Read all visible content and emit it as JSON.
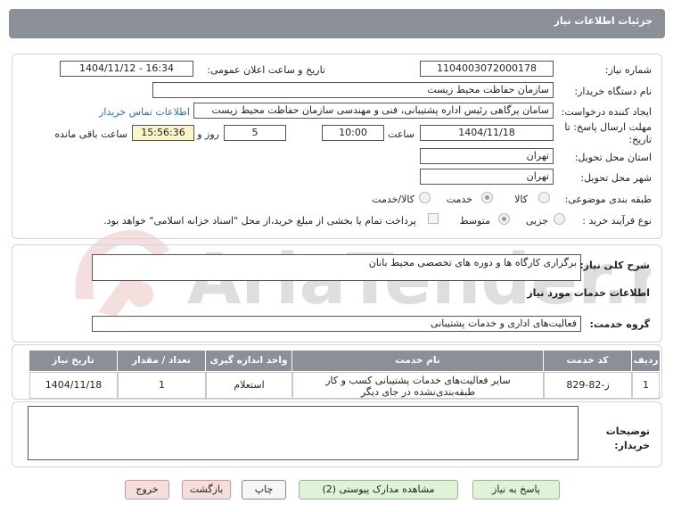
{
  "header": {
    "title": "جزئیات اطلاعات نیاز"
  },
  "watermark": {
    "text": "AriaTender.net"
  },
  "form": {
    "need_number_label": "شماره نیاز:",
    "need_number": "1104003072000178",
    "announce_label": "تاریخ و ساعت اعلان عمومی:",
    "announce_value": "1404/11/12 - 16:34",
    "buyer_org_label": "نام دستگاه خریدار:",
    "buyer_org": "سازمان حفاظت محیط زیست",
    "creator_label": "ایجاد کننده درخواست:",
    "creator": "سامان پرگاهی رئیس اداره پشتیبانی، فنی و مهندسی سازمان حفاظت محیط زیست",
    "contact_link": "اطلاعات تماس خریدار",
    "deadline_label": "مهلت ارسال پاسخ: تا تاریخ:",
    "deadline_date": "1404/11/18",
    "time_label": "ساعت",
    "deadline_time": "10:00",
    "days_value": "5",
    "days_label": "روز و",
    "remaining_time": "15:56:36",
    "remaining_label": "ساعت باقی مانده",
    "province_label": "استان محل تحویل:",
    "province": "تهران",
    "city_label": "شهر محل تحویل:",
    "city": "تهران",
    "category_label": "طبقه بندی موضوعی:",
    "category_options": [
      "کالا",
      "خدمت",
      "کالا/خدمت"
    ],
    "category_selected": "خدمت",
    "process_label": "نوع فرآیند خرید :",
    "process_options": [
      "جزیی",
      "متوسط"
    ],
    "process_selected": "متوسط",
    "payment_note": "پرداخت تمام یا بخشی از مبلغ خرید،از محل \"اسناد خزانه اسلامی\" خواهد بود."
  },
  "summary": {
    "label": "شرح کلی نیاز:",
    "value": "برگزاری کارگاه ها و دوره های تخصصی محیط بانان"
  },
  "services": {
    "section_title": "اطلاعات خدمات مورد نیاز",
    "group_label": "گروه خدمت:",
    "group_value": "فعالیت‌های اداری و خدمات پشتیبانی",
    "columns": [
      "ردیف",
      "کد خدمت",
      "نام خدمت",
      "واحد اندازه گیری",
      "تعداد / مقدار",
      "تاریخ نیاز"
    ],
    "rows": [
      {
        "row": "1",
        "code": "ز-82-829",
        "name": "سایر فعالیت‌های خدمات پشتیبانی کسب و کار طبقه‌بندی‌نشده در جای دیگر",
        "unit": "استعلام",
        "qty": "1",
        "date": "1404/11/18"
      }
    ]
  },
  "notes": {
    "label": "توضیحات خریدار:",
    "value": ""
  },
  "buttons": {
    "reply": "پاسخ به نیاز",
    "attachments": "مشاهده مدارک پیوستی (2)",
    "print": "چاپ",
    "back": "بازگشت",
    "exit": "خروج"
  }
}
